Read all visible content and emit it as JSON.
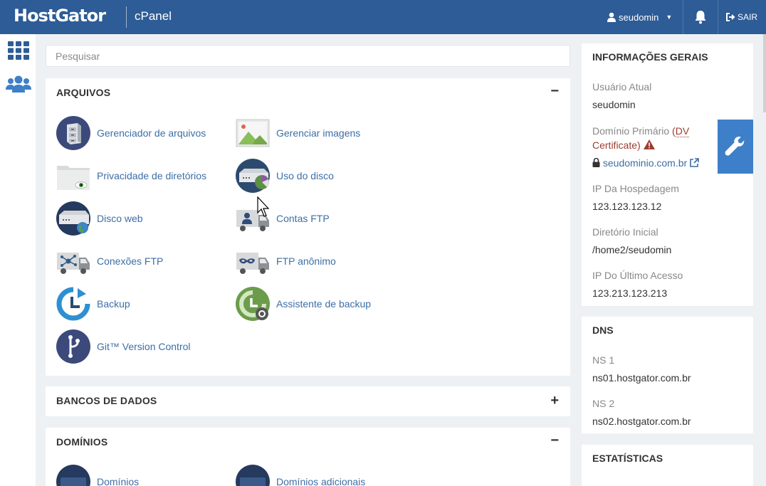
{
  "header": {
    "brand": "HostGator",
    "product": "cPanel",
    "username": "seudomin",
    "logout_label": "SAIR",
    "brand_color": "#2d5c96"
  },
  "search": {
    "placeholder": "Pesquisar",
    "value": ""
  },
  "sections": {
    "arquivos": {
      "title": "ARQUIVOS",
      "toggle": "−",
      "items": [
        {
          "label": "Gerenciador de arquivos",
          "icon": "file-cabinet-icon"
        },
        {
          "label": "Gerenciar imagens",
          "icon": "image-icon"
        },
        {
          "label": "Privacidade de diretórios",
          "icon": "folder-eye-icon"
        },
        {
          "label": "Uso do disco",
          "icon": "disk-usage-icon"
        },
        {
          "label": "Disco web",
          "icon": "web-disk-icon"
        },
        {
          "label": "Contas FTP",
          "icon": "ftp-accounts-icon"
        },
        {
          "label": "Conexões FTP",
          "icon": "ftp-connections-icon"
        },
        {
          "label": "FTP anônimo",
          "icon": "anonymous-ftp-icon"
        },
        {
          "label": "Backup",
          "icon": "backup-icon"
        },
        {
          "label": "Assistente de backup",
          "icon": "backup-wizard-icon"
        },
        {
          "label": "Git™ Version Control",
          "icon": "git-icon"
        }
      ]
    },
    "bancos": {
      "title": "BANCOS DE DADOS",
      "toggle": "+"
    },
    "dominios": {
      "title": "DOMÍNIOS",
      "toggle": "−",
      "items": [
        {
          "label": "Domínios",
          "icon": "domain-icon"
        },
        {
          "label": "Domínios adicionais",
          "icon": "addon-domain-icon"
        }
      ]
    }
  },
  "general_info": {
    "title": "INFORMAÇÕES GERAIS",
    "current_user_label": "Usuário Atual",
    "current_user": "seudomin",
    "primary_domain_label": "Domínio Primário",
    "cert_link": "(DV Certificate)",
    "cert_open": "(",
    "cert_dv": "DV",
    "cert_rest": "Certificate)",
    "domain": "seudominio.com.br",
    "host_ip_label": "IP Da Hospedagem",
    "host_ip": "123.123.123.12",
    "home_dir_label": "Diretório Inicial",
    "home_dir": "/home2/seudomin",
    "last_ip_label": "IP Do Último Acesso",
    "last_ip": "123.213.123.213"
  },
  "dns": {
    "title": "DNS",
    "ns1_label": "NS 1",
    "ns1": "ns01.hostgator.com.br",
    "ns2_label": "NS 2",
    "ns2": "ns02.hostgator.com.br"
  },
  "stats": {
    "title": "ESTATÍSTICAS"
  }
}
